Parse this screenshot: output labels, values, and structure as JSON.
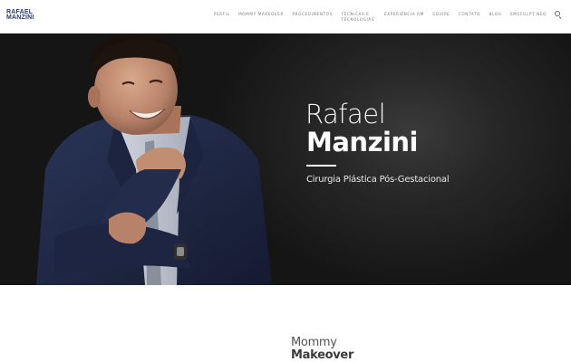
{
  "header": {
    "logo_line1": "RAFAEL",
    "logo_line2": "MANZINI",
    "nav": [
      {
        "label": "Perfil"
      },
      {
        "label": "Mommy Makeover"
      },
      {
        "label": "Procedimentos"
      },
      {
        "label": "Técnicas e Tecnologias"
      },
      {
        "label": "Experiência RM"
      },
      {
        "label": "Equipe"
      },
      {
        "label": "Contato"
      },
      {
        "label": "Blog"
      },
      {
        "label": "Emsculpt Neo"
      }
    ],
    "search_icon": "search-icon"
  },
  "hero": {
    "first_name": "Rafael",
    "last_name": "Manzini",
    "tagline": "Cirurgia Plástica Pós-Gestacional"
  },
  "section": {
    "title_line1": "Mommy",
    "title_line2": "Makeover"
  },
  "colors": {
    "logo": "#2c3a6b",
    "nav_text": "#7a7a7a",
    "hero_bg": "#1a1a1a",
    "suit": "#232c4a"
  }
}
